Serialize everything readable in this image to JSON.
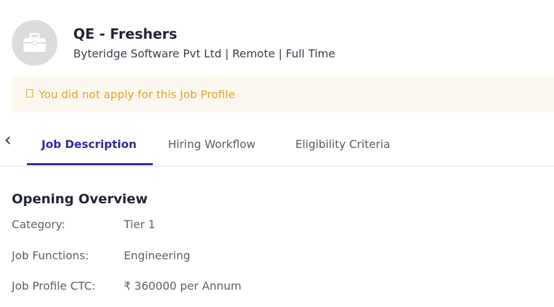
{
  "job": {
    "title": "QE - Freshers",
    "subtitle": "Byteridge Software Pvt Ltd | Remote | Full Time",
    "logo_icon": "briefcase-icon"
  },
  "notice": {
    "text": "You did not apply for this Job Profile",
    "color": "#e0a22a",
    "background": "#fdf8ef"
  },
  "tabs": [
    {
      "label": "Job Description",
      "active": true
    },
    {
      "label": "Hiring Workflow",
      "active": false
    },
    {
      "label": "Eligibility Criteria",
      "active": false
    }
  ],
  "accent_color": "#2e2a9e",
  "overview": {
    "title": "Opening Overview",
    "rows": [
      {
        "label": "Category:",
        "value": "Tier 1"
      },
      {
        "label": "Job Functions:",
        "value": "Engineering"
      },
      {
        "label": "Job Profile CTC:",
        "value": "₹ 360000 per Annum"
      }
    ]
  }
}
